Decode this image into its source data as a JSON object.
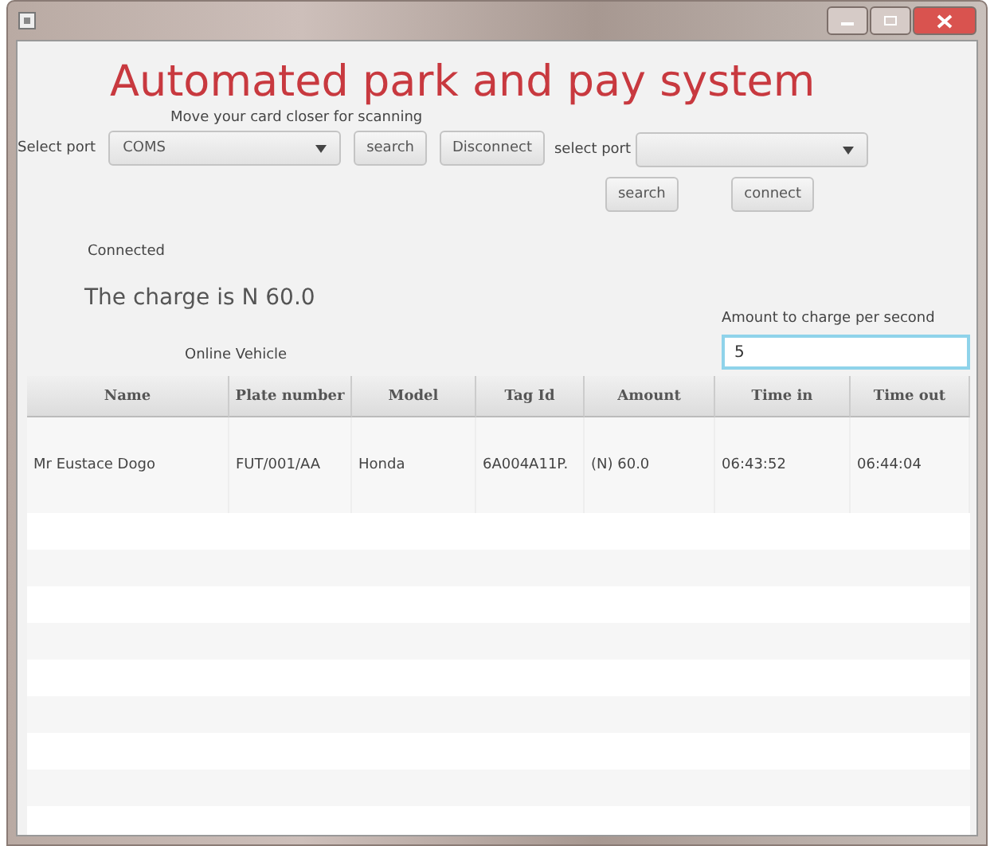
{
  "window": {
    "title": "Automated park and pay system"
  },
  "reader": {
    "hint": "Move your card closer for scanning",
    "port_label": "Select port",
    "port_value": "COMS",
    "search_button": "search",
    "disconnect_button": "Disconnect"
  },
  "device": {
    "port_label": "select port",
    "search_button": "search",
    "connect_button": "connect"
  },
  "status": "Connected",
  "charge": "The charge is N 60.0",
  "rate": {
    "label": "Amount to charge per second",
    "value": "5"
  },
  "table": {
    "title": "Online Vehicle",
    "columns": [
      "Name",
      "Plate number",
      "Model",
      "Tag Id",
      "Amount",
      "Time in",
      "Time out"
    ],
    "rows": [
      [
        "Mr Eustace Dogo",
        "FUT/001/AA",
        "Honda",
        "6A004A11P.",
        "(N) 60.0",
        "06:43:52",
        "06:44:04"
      ]
    ]
  }
}
